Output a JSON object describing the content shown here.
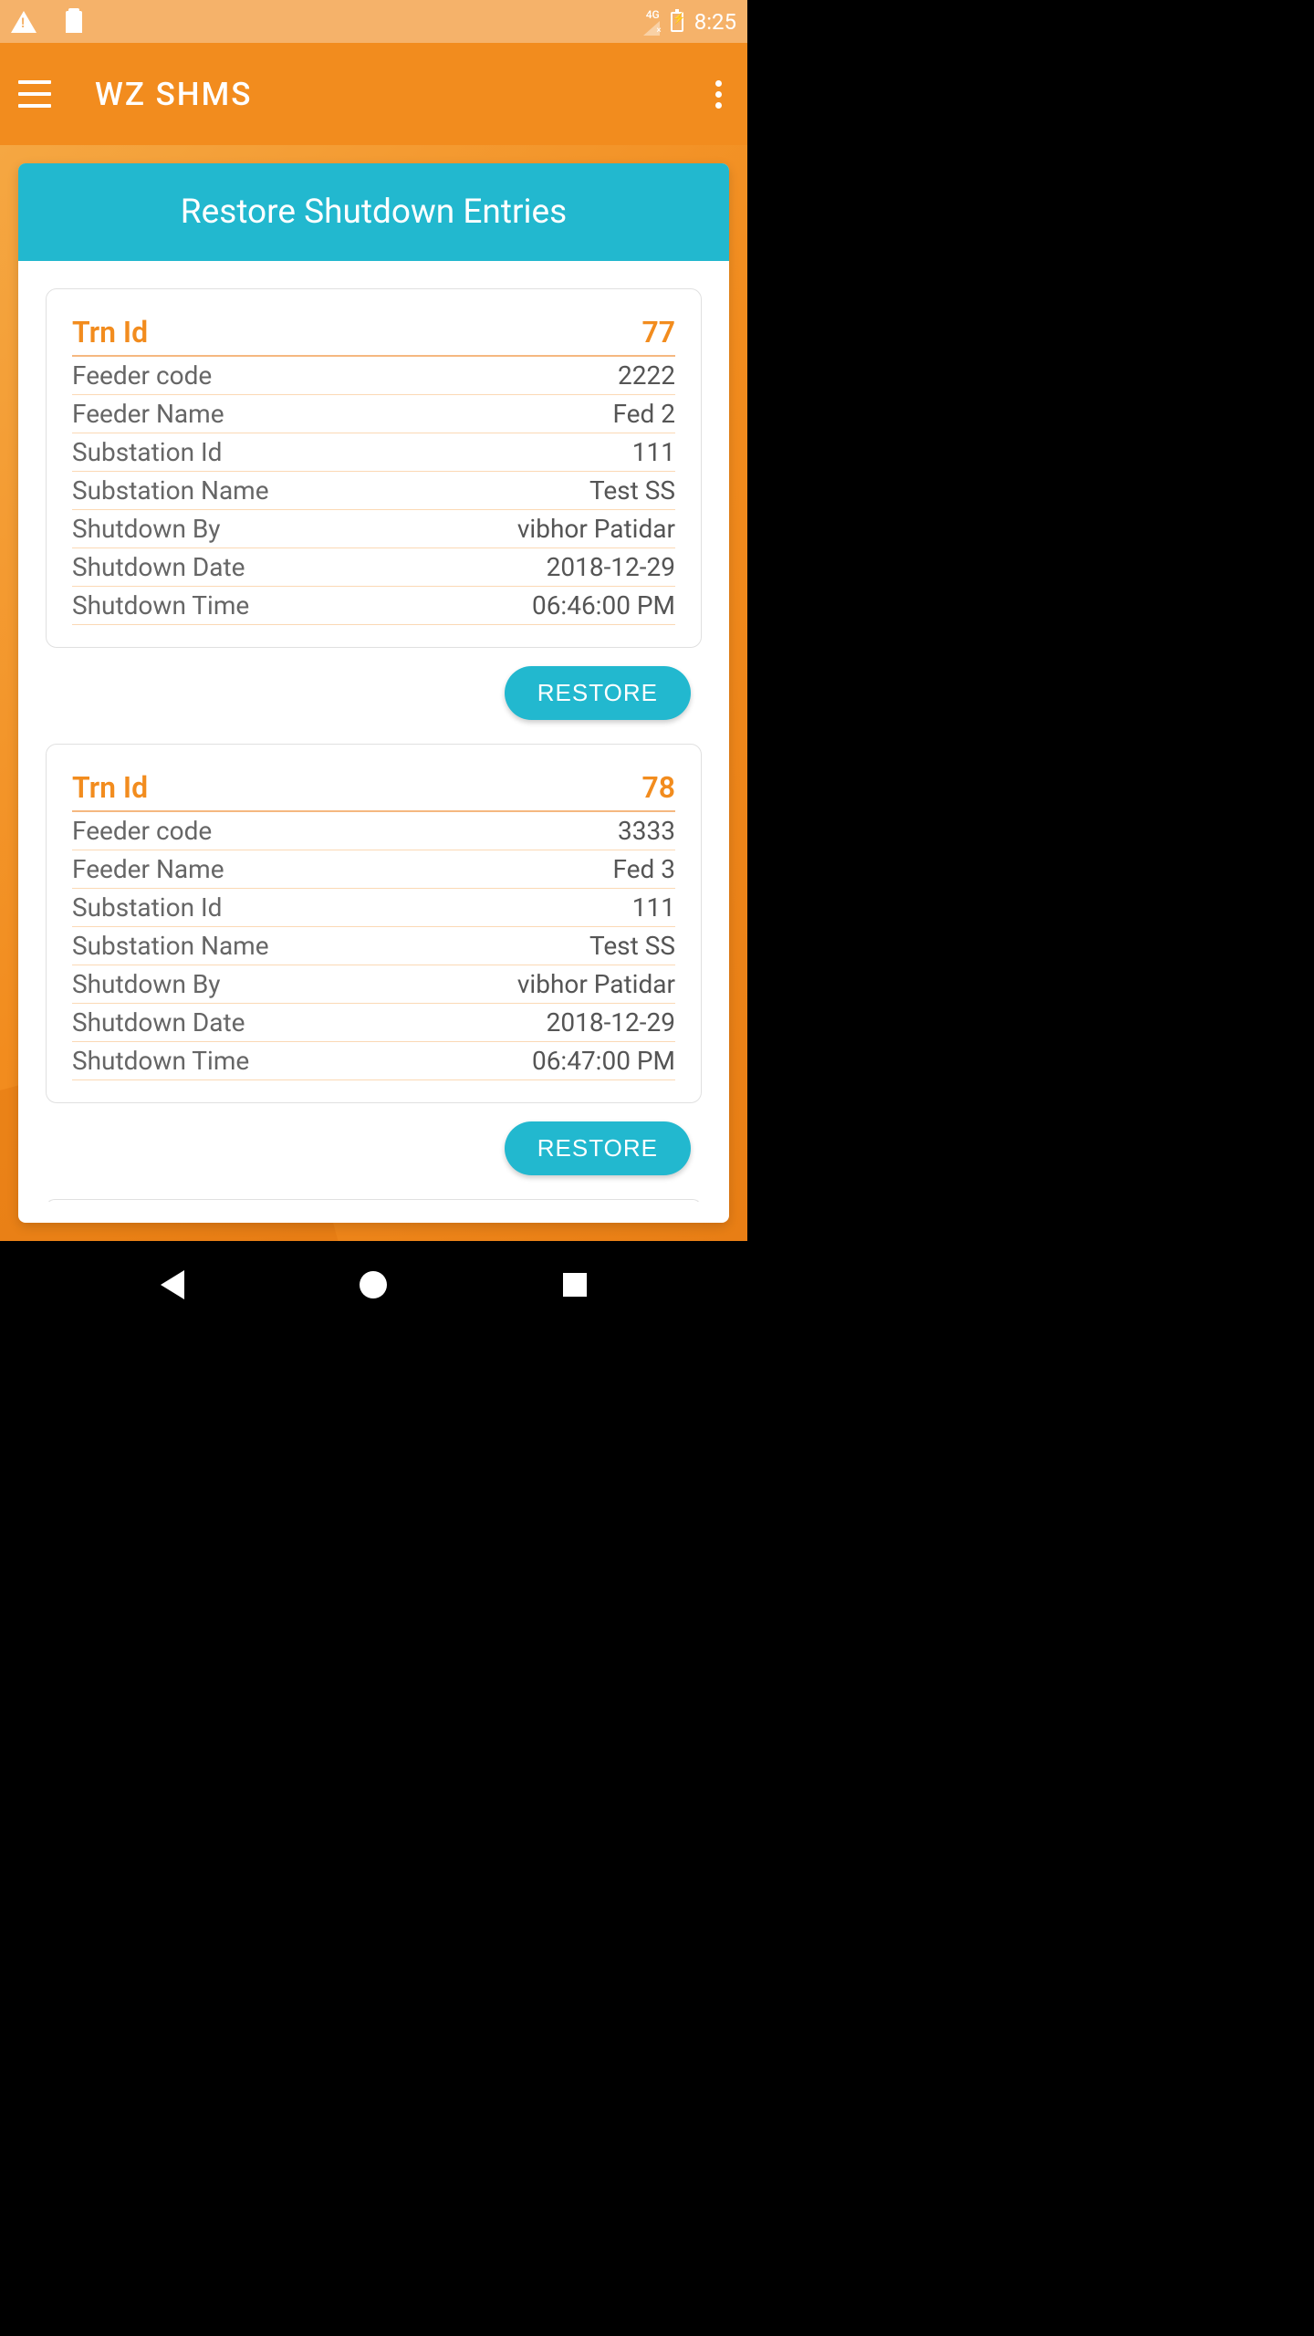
{
  "status": {
    "network": "4G",
    "time": "8:25"
  },
  "app": {
    "title": "WZ SHMS"
  },
  "page": {
    "title": "Restore Shutdown Entries"
  },
  "labels": {
    "trn_id": "Trn Id",
    "feeder_code": "Feeder code",
    "feeder_name": "Feeder Name",
    "substation_id": "Substation Id",
    "substation_name": "Substation Name",
    "shutdown_by": "Shutdown By",
    "shutdown_date": "Shutdown Date",
    "shutdown_time": "Shutdown Time",
    "restore": "RESTORE"
  },
  "entries": [
    {
      "trn_id": "77",
      "feeder_code": "2222",
      "feeder_name": "Fed 2",
      "substation_id": "111",
      "substation_name": "Test SS",
      "shutdown_by": "vibhor Patidar",
      "shutdown_date": "2018-12-29",
      "shutdown_time": "06:46:00 PM"
    },
    {
      "trn_id": "78",
      "feeder_code": "3333",
      "feeder_name": "Fed 3",
      "substation_id": "111",
      "substation_name": "Test SS",
      "shutdown_by": "vibhor Patidar",
      "shutdown_date": "2018-12-29",
      "shutdown_time": "06:47:00 PM"
    }
  ]
}
